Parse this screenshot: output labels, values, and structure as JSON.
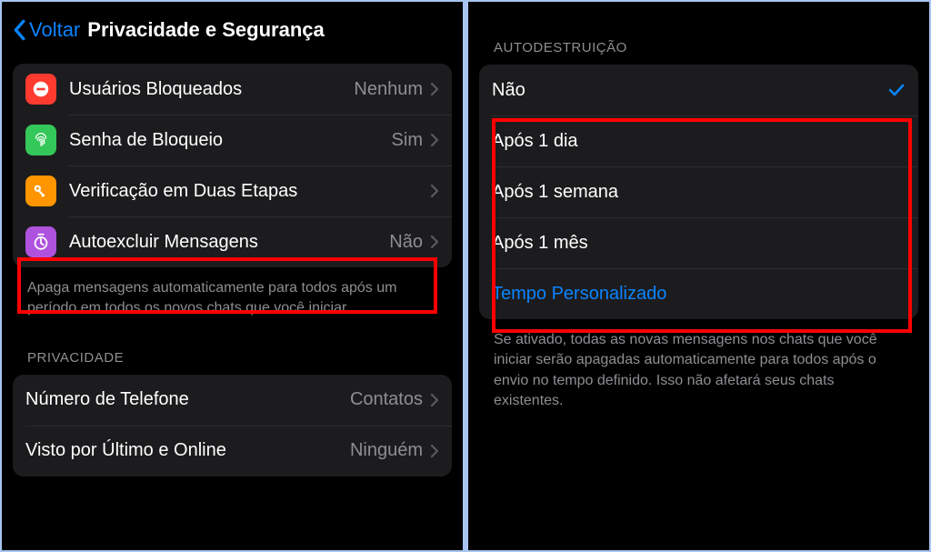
{
  "left": {
    "back_label": "Voltar",
    "title": "Privacidade e Segurança",
    "rows": {
      "blocked": {
        "label": "Usuários Bloqueados",
        "value": "Nenhum"
      },
      "passcode": {
        "label": "Senha de Bloqueio",
        "value": "Sim"
      },
      "twostep": {
        "label": "Verificação em Duas Etapas",
        "value": ""
      },
      "autodelete": {
        "label": "Autoexcluir Mensagens",
        "value": "Não"
      }
    },
    "autodelete_footer": "Apaga mensagens automaticamente para todos após um período em todos os novos chats que você iniciar.",
    "privacy_header": "PRIVACIDADE",
    "privacy_rows": {
      "phone": {
        "label": "Número de Telefone",
        "value": "Contatos"
      },
      "lastseen": {
        "label": "Visto por Último e Online",
        "value": "Ninguém"
      }
    }
  },
  "right": {
    "section_header": "AUTODESTRUIÇÃO",
    "options": {
      "off": "Não",
      "day": "Após 1 dia",
      "week": "Após 1 semana",
      "month": "Após 1 mês",
      "custom": "Tempo Personalizado"
    },
    "footer": "Se ativado, todas as novas mensagens nos chats que você iniciar serão apagadas automaticamente para todos após o envio no tempo definido. Isso não afetará seus chats existentes."
  }
}
